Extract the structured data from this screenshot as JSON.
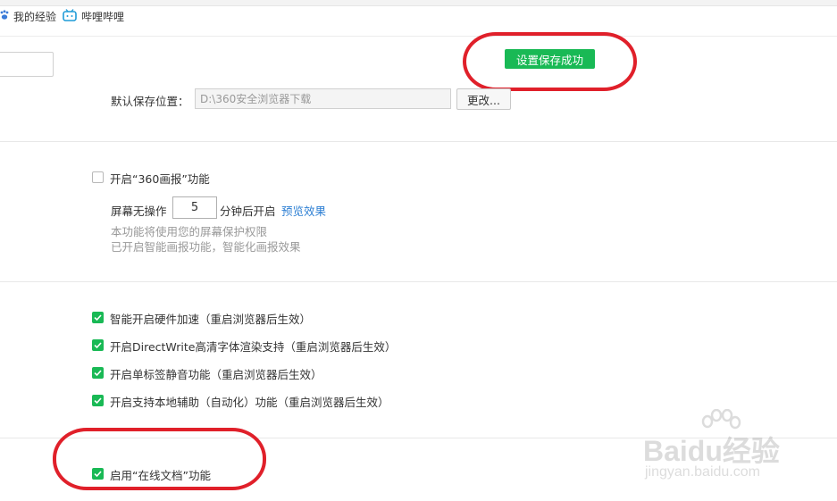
{
  "bookmarks": [
    {
      "label": "我的经验",
      "icon": "paw-icon"
    },
    {
      "label": "哔哩哔哩",
      "icon": "bilibili-tv-icon"
    }
  ],
  "toast": {
    "text": "设置保存成功"
  },
  "download": {
    "label": "默认保存位置：",
    "path": "D:\\360安全浏览器下载",
    "change_button": "更改..."
  },
  "screensaver": {
    "checkbox_label": "开启“360画报”功能",
    "checked": false,
    "idle_prefix": "屏幕无操作",
    "idle_minutes": "5",
    "idle_suffix": "分钟后开启",
    "preview_link": "预览效果",
    "hint1": "本功能将使用您的屏幕保护权限",
    "hint2": "已开启智能画报功能，智能化画报效果"
  },
  "advanced": [
    {
      "label": "智能开启硬件加速（重启浏览器后生效）",
      "checked": true
    },
    {
      "label": "开启DirectWrite高清字体渲染支持（重启浏览器后生效）",
      "checked": true
    },
    {
      "label": "开启单标签静音功能（重启浏览器后生效）",
      "checked": true
    },
    {
      "label": "开启支持本地辅助（自动化）功能（重启浏览器后生效）",
      "checked": true
    }
  ],
  "online_docs": {
    "label": "启用“在线文档”功能",
    "checked": true
  },
  "watermark": {
    "brand": "Baidu经验",
    "url": "jingyan.baidu.com"
  },
  "colors": {
    "accent": "#19b955",
    "link": "#2d7fd3",
    "annotation": "#e0202a"
  }
}
